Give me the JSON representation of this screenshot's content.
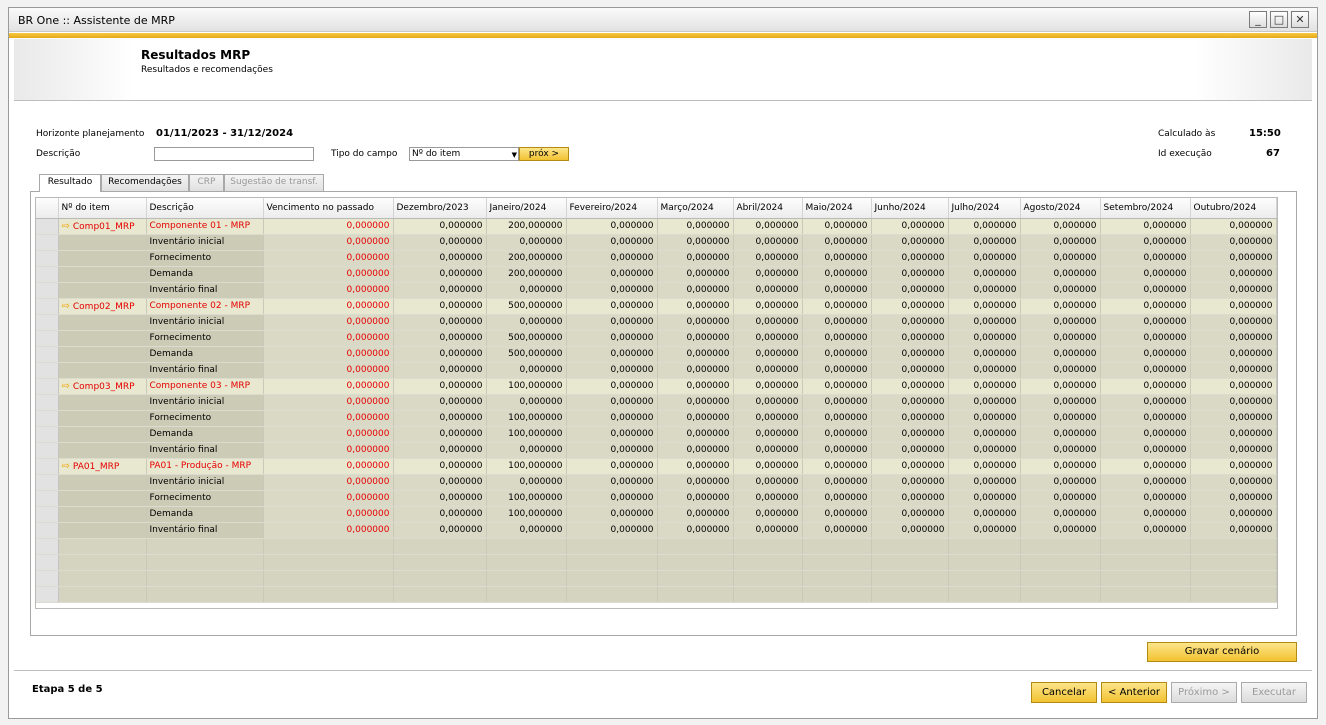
{
  "window": {
    "title": "BR One :: Assistente de MRP"
  },
  "header": {
    "title": "Resultados MRP",
    "subtitle": "Resultados e recomendações"
  },
  "form": {
    "horizonte_label": "Horizonte planejamento",
    "horizonte_value": "01/11/2023  -  31/12/2024",
    "descricao_label": "Descrição",
    "descricao_value": "",
    "tipo_label": "Tipo do campo",
    "tipo_value": "Nº do item",
    "prox_label": "próx >",
    "calculado_label": "Calculado às",
    "calculado_value": "15:50",
    "id_label": "Id execução",
    "id_value": "67"
  },
  "tabs": [
    {
      "label": "Resultado",
      "state": "active"
    },
    {
      "label": "Recomendações",
      "state": "normal"
    },
    {
      "label": "CRP",
      "state": "disabled"
    },
    {
      "label": "Sugestão de transf.",
      "state": "disabled"
    }
  ],
  "grid": {
    "columns": [
      "Nº do item",
      "Descrição",
      "Vencimento no passado",
      "Dezembro/2023",
      "Janeiro/2024",
      "Fevereiro/2024",
      "Março/2024",
      "Abril/2024",
      "Maio/2024",
      "Junho/2024",
      "Julho/2024",
      "Agosto/2024",
      "Setembro/2024",
      "Outubro/2024"
    ],
    "rows": [
      {
        "type": "item",
        "item": "Comp01_MRP",
        "desc": "Componente 01 - MRP",
        "past": "0,000000",
        "values": [
          "0,000000",
          "200,000000",
          "0,000000",
          "0,000000",
          "0,000000",
          "0,000000",
          "0,000000",
          "0,000000",
          "0,000000",
          "0,000000",
          "0,000000"
        ]
      },
      {
        "type": "sub",
        "item": "",
        "desc": "Inventário inicial",
        "past": "0,000000",
        "values": [
          "0,000000",
          "0,000000",
          "0,000000",
          "0,000000",
          "0,000000",
          "0,000000",
          "0,000000",
          "0,000000",
          "0,000000",
          "0,000000",
          "0,000000"
        ]
      },
      {
        "type": "sub",
        "item": "",
        "desc": "Fornecimento",
        "past": "0,000000",
        "values": [
          "0,000000",
          "200,000000",
          "0,000000",
          "0,000000",
          "0,000000",
          "0,000000",
          "0,000000",
          "0,000000",
          "0,000000",
          "0,000000",
          "0,000000"
        ]
      },
      {
        "type": "sub",
        "item": "",
        "desc": "Demanda",
        "past": "0,000000",
        "values": [
          "0,000000",
          "200,000000",
          "0,000000",
          "0,000000",
          "0,000000",
          "0,000000",
          "0,000000",
          "0,000000",
          "0,000000",
          "0,000000",
          "0,000000"
        ]
      },
      {
        "type": "sub",
        "item": "",
        "desc": "Inventário final",
        "past": "0,000000",
        "values": [
          "0,000000",
          "0,000000",
          "0,000000",
          "0,000000",
          "0,000000",
          "0,000000",
          "0,000000",
          "0,000000",
          "0,000000",
          "0,000000",
          "0,000000"
        ]
      },
      {
        "type": "item",
        "item": "Comp02_MRP",
        "desc": "Componente 02 - MRP",
        "past": "0,000000",
        "values": [
          "0,000000",
          "500,000000",
          "0,000000",
          "0,000000",
          "0,000000",
          "0,000000",
          "0,000000",
          "0,000000",
          "0,000000",
          "0,000000",
          "0,000000"
        ]
      },
      {
        "type": "sub",
        "item": "",
        "desc": "Inventário inicial",
        "past": "0,000000",
        "values": [
          "0,000000",
          "0,000000",
          "0,000000",
          "0,000000",
          "0,000000",
          "0,000000",
          "0,000000",
          "0,000000",
          "0,000000",
          "0,000000",
          "0,000000"
        ]
      },
      {
        "type": "sub",
        "item": "",
        "desc": "Fornecimento",
        "past": "0,000000",
        "values": [
          "0,000000",
          "500,000000",
          "0,000000",
          "0,000000",
          "0,000000",
          "0,000000",
          "0,000000",
          "0,000000",
          "0,000000",
          "0,000000",
          "0,000000"
        ]
      },
      {
        "type": "sub",
        "item": "",
        "desc": "Demanda",
        "past": "0,000000",
        "values": [
          "0,000000",
          "500,000000",
          "0,000000",
          "0,000000",
          "0,000000",
          "0,000000",
          "0,000000",
          "0,000000",
          "0,000000",
          "0,000000",
          "0,000000"
        ]
      },
      {
        "type": "sub",
        "item": "",
        "desc": "Inventário final",
        "past": "0,000000",
        "values": [
          "0,000000",
          "0,000000",
          "0,000000",
          "0,000000",
          "0,000000",
          "0,000000",
          "0,000000",
          "0,000000",
          "0,000000",
          "0,000000",
          "0,000000"
        ]
      },
      {
        "type": "item",
        "item": "Comp03_MRP",
        "desc": "Componente 03 - MRP",
        "past": "0,000000",
        "values": [
          "0,000000",
          "100,000000",
          "0,000000",
          "0,000000",
          "0,000000",
          "0,000000",
          "0,000000",
          "0,000000",
          "0,000000",
          "0,000000",
          "0,000000"
        ]
      },
      {
        "type": "sub",
        "item": "",
        "desc": "Inventário inicial",
        "past": "0,000000",
        "values": [
          "0,000000",
          "0,000000",
          "0,000000",
          "0,000000",
          "0,000000",
          "0,000000",
          "0,000000",
          "0,000000",
          "0,000000",
          "0,000000",
          "0,000000"
        ]
      },
      {
        "type": "sub",
        "item": "",
        "desc": "Fornecimento",
        "past": "0,000000",
        "values": [
          "0,000000",
          "100,000000",
          "0,000000",
          "0,000000",
          "0,000000",
          "0,000000",
          "0,000000",
          "0,000000",
          "0,000000",
          "0,000000",
          "0,000000"
        ]
      },
      {
        "type": "sub",
        "item": "",
        "desc": "Demanda",
        "past": "0,000000",
        "values": [
          "0,000000",
          "100,000000",
          "0,000000",
          "0,000000",
          "0,000000",
          "0,000000",
          "0,000000",
          "0,000000",
          "0,000000",
          "0,000000",
          "0,000000"
        ]
      },
      {
        "type": "sub",
        "item": "",
        "desc": "Inventário final",
        "past": "0,000000",
        "values": [
          "0,000000",
          "0,000000",
          "0,000000",
          "0,000000",
          "0,000000",
          "0,000000",
          "0,000000",
          "0,000000",
          "0,000000",
          "0,000000",
          "0,000000"
        ]
      },
      {
        "type": "item",
        "item": "PA01_MRP",
        "desc": "PA01 - Produção - MRP",
        "past": "0,000000",
        "values": [
          "0,000000",
          "100,000000",
          "0,000000",
          "0,000000",
          "0,000000",
          "0,000000",
          "0,000000",
          "0,000000",
          "0,000000",
          "0,000000",
          "0,000000"
        ]
      },
      {
        "type": "sub",
        "item": "",
        "desc": "Inventário inicial",
        "past": "0,000000",
        "values": [
          "0,000000",
          "0,000000",
          "0,000000",
          "0,000000",
          "0,000000",
          "0,000000",
          "0,000000",
          "0,000000",
          "0,000000",
          "0,000000",
          "0,000000"
        ]
      },
      {
        "type": "sub",
        "item": "",
        "desc": "Fornecimento",
        "past": "0,000000",
        "values": [
          "0,000000",
          "100,000000",
          "0,000000",
          "0,000000",
          "0,000000",
          "0,000000",
          "0,000000",
          "0,000000",
          "0,000000",
          "0,000000",
          "0,000000"
        ]
      },
      {
        "type": "sub",
        "item": "",
        "desc": "Demanda",
        "past": "0,000000",
        "values": [
          "0,000000",
          "100,000000",
          "0,000000",
          "0,000000",
          "0,000000",
          "0,000000",
          "0,000000",
          "0,000000",
          "0,000000",
          "0,000000",
          "0,000000"
        ]
      },
      {
        "type": "sub",
        "item": "",
        "desc": "Inventário final",
        "past": "0,000000",
        "values": [
          "0,000000",
          "0,000000",
          "0,000000",
          "0,000000",
          "0,000000",
          "0,000000",
          "0,000000",
          "0,000000",
          "0,000000",
          "0,000000",
          "0,000000"
        ]
      }
    ],
    "empty_rows": 4
  },
  "buttons": {
    "gravar": "Gravar cenário",
    "cancelar": "Cancelar",
    "anterior": "< Anterior",
    "proximo": "Próximo >",
    "executar": "Executar"
  },
  "footer": {
    "etapa": "Etapa 5 de 5"
  },
  "colors": {
    "accent": "#f2c231",
    "red_text": "#e60000",
    "grid_item_row": "#e8e8d0",
    "grid_sub_row": "#d9d9c6"
  }
}
